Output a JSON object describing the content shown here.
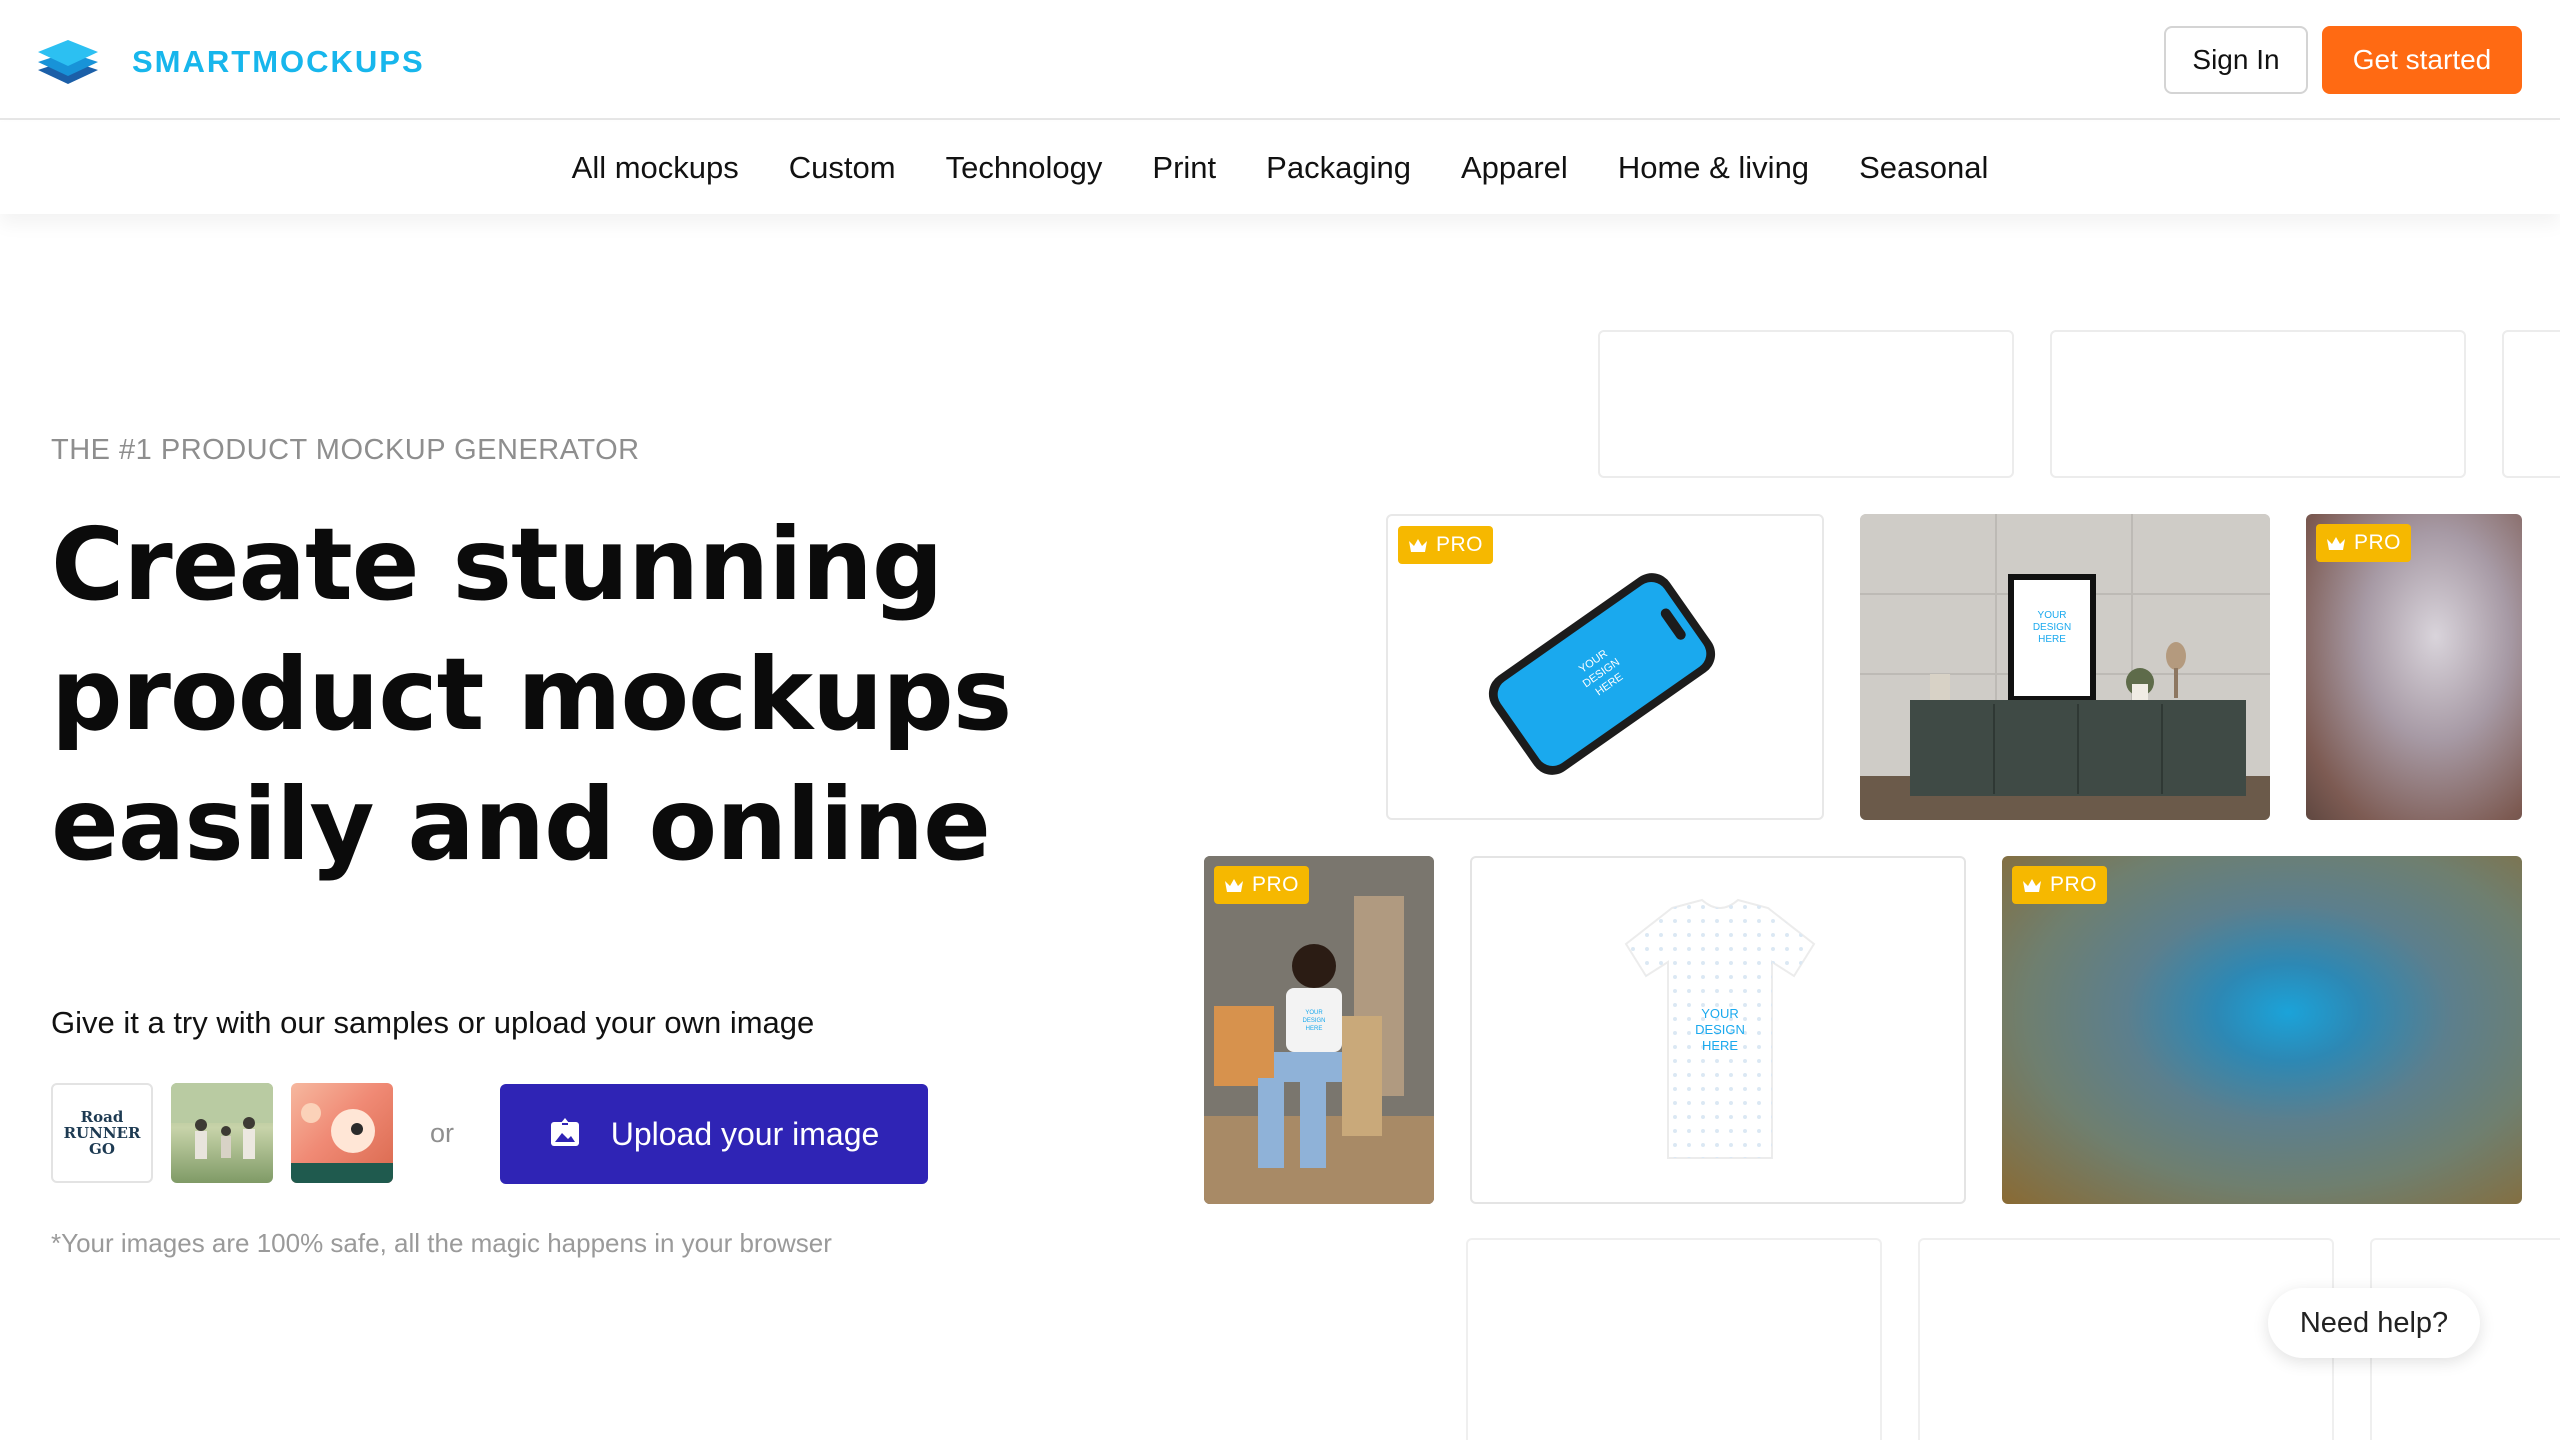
{
  "brand": {
    "name": "SMARTMOCKUPS",
    "color": "#17b6ec"
  },
  "header": {
    "sign_in": "Sign In",
    "get_started": "Get started",
    "get_started_color": "#ff6a13"
  },
  "categories": [
    "All mockups",
    "Custom",
    "Technology",
    "Print",
    "Packaging",
    "Apparel",
    "Home & living",
    "Seasonal"
  ],
  "hero": {
    "eyebrow": "THE #1 PRODUCT MOCKUP GENERATOR",
    "headline_lines": [
      "Create stunning",
      "product mockups",
      "easily and online"
    ],
    "try_text": "Give it a try with our samples or upload your own image",
    "or_text": "or",
    "upload_label": "Upload your image",
    "upload_color": "#2f24b5",
    "safety_note": "*Your images are 100% safe, all the magic happens in your browser"
  },
  "samples": [
    {
      "name": "road-runner-logo",
      "text": [
        "Road",
        "RUNNER",
        "GO"
      ]
    },
    {
      "name": "family-photo"
    },
    {
      "name": "illustration"
    }
  ],
  "mockups": {
    "pro_label": "PRO",
    "placeholder": [
      "YOUR",
      "DESIGN",
      "HERE"
    ]
  },
  "help": {
    "label": "Need help?"
  }
}
